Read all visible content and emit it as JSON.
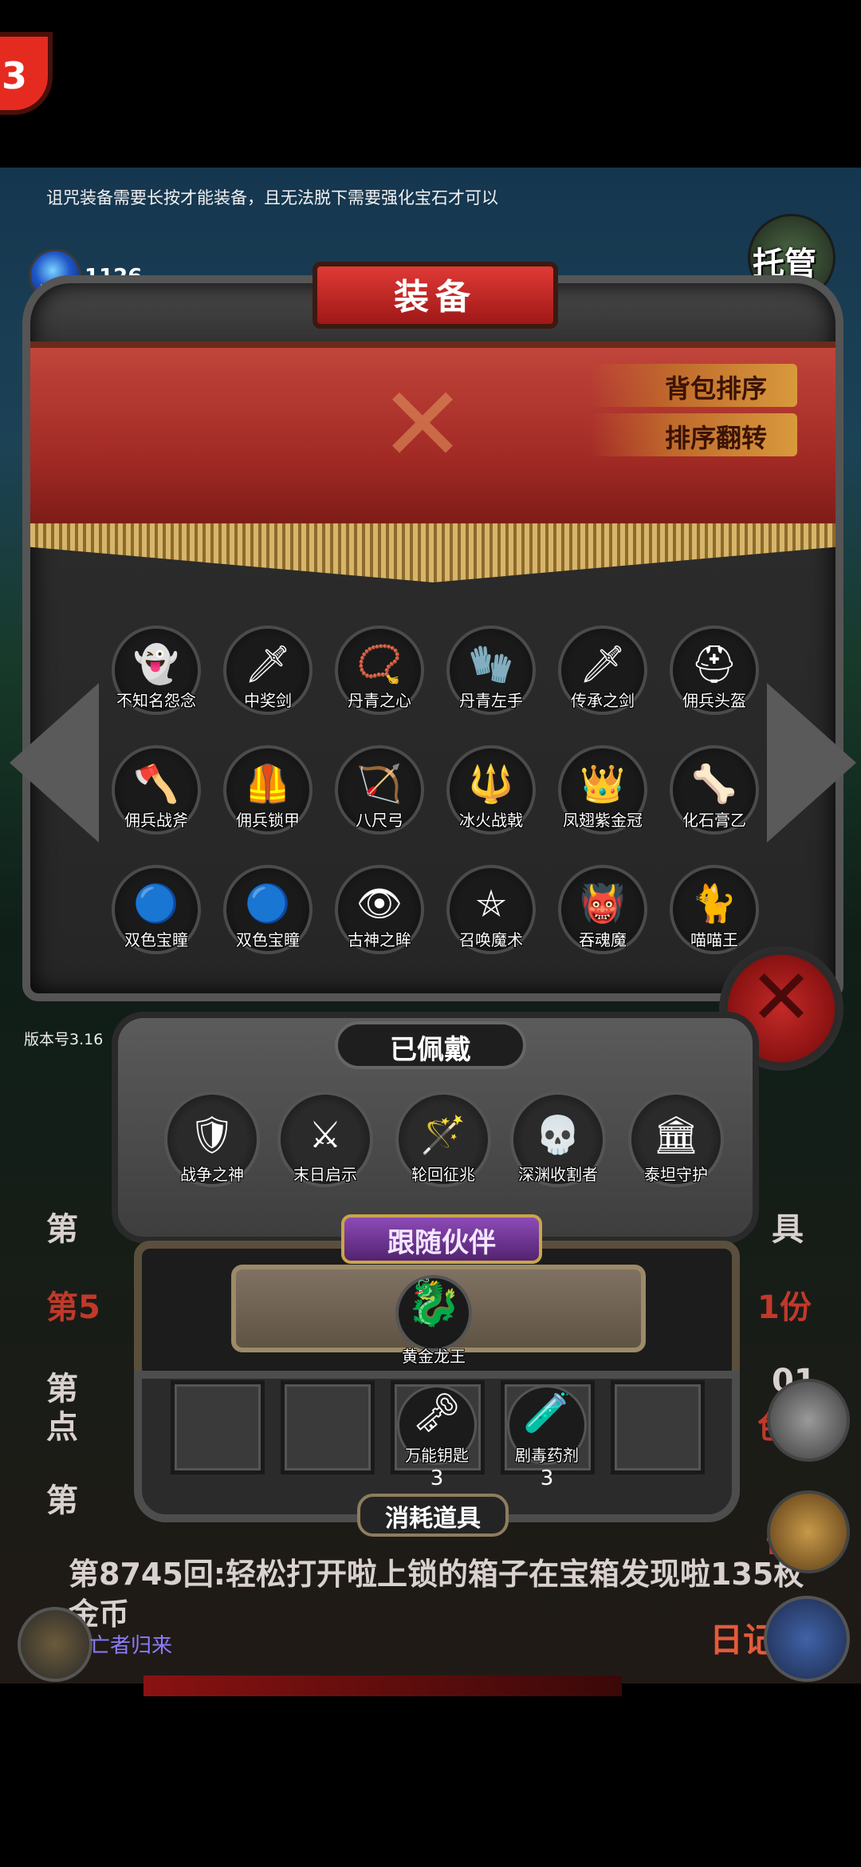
{
  "hint": "诅咒装备需要长按才能装备，且无法脱下需要强化宝石才可以",
  "gems": {
    "count": "1126",
    "label": "宝石"
  },
  "auto_label": "托管",
  "version": "版本号3.16",
  "equip_panel": {
    "title": "装备",
    "sort_button": "背包排序",
    "reverse_button": "排序翻转",
    "items": [
      {
        "name": "不知名怨念",
        "icon": "ghost-icon",
        "glyph": "👻"
      },
      {
        "name": "中奖剑",
        "icon": "sword-icon",
        "glyph": "🗡"
      },
      {
        "name": "丹青之心",
        "icon": "amulet-icon",
        "glyph": "📿"
      },
      {
        "name": "丹青左手",
        "icon": "glove-icon",
        "glyph": "🧤"
      },
      {
        "name": "传承之剑",
        "icon": "sword-icon",
        "glyph": "🗡"
      },
      {
        "name": "佣兵头盔",
        "icon": "helmet-icon",
        "glyph": "⛑"
      },
      {
        "name": "佣兵战斧",
        "icon": "axe-icon",
        "glyph": "🪓"
      },
      {
        "name": "佣兵锁甲",
        "icon": "armor-icon",
        "glyph": "🦺"
      },
      {
        "name": "八尺弓",
        "icon": "bow-icon",
        "glyph": "🏹"
      },
      {
        "name": "冰火战戟",
        "icon": "halberd-icon",
        "glyph": "🔱"
      },
      {
        "name": "凤翅紫金冠",
        "icon": "crown-icon",
        "glyph": "👑"
      },
      {
        "name": "化石膏乙",
        "icon": "bone-icon",
        "glyph": "🦴"
      },
      {
        "name": "双色宝瞳",
        "icon": "pendant-icon",
        "glyph": "🔵"
      },
      {
        "name": "双色宝瞳",
        "icon": "pendant-icon",
        "glyph": "🔵"
      },
      {
        "name": "古神之眸",
        "icon": "eye-icon",
        "glyph": "👁"
      },
      {
        "name": "召唤魔术",
        "icon": "pentagram-icon",
        "glyph": "⛤"
      },
      {
        "name": "吞魂魔",
        "icon": "demon-icon",
        "glyph": "👹"
      },
      {
        "name": "喵喵王",
        "icon": "cat-icon",
        "glyph": "🐈"
      }
    ]
  },
  "worn_panel": {
    "title": "已佩戴",
    "items": [
      {
        "name": "战争之神",
        "icon": "war-god-icon",
        "glyph": "🛡"
      },
      {
        "name": "末日启示",
        "icon": "crossed-weapons-icon",
        "glyph": "⚔"
      },
      {
        "name": "轮回征兆",
        "icon": "staff-icon",
        "glyph": "🪄"
      },
      {
        "name": "深渊收割者",
        "icon": "reaper-icon",
        "glyph": "💀"
      },
      {
        "name": "泰坦守护",
        "icon": "titan-armor-icon",
        "glyph": "🏛"
      }
    ]
  },
  "companion": {
    "title": "跟随伙伴",
    "name": "黄金龙王",
    "icon": "golden-dragon-icon",
    "glyph": "🐉"
  },
  "consumables": {
    "title": "消耗道具",
    "items": [
      {
        "name": "",
        "qty": ""
      },
      {
        "name": "",
        "qty": ""
      },
      {
        "name": "万能钥匙",
        "qty": "3",
        "icon": "key-icon",
        "glyph": "🗝"
      },
      {
        "name": "剧毒药剂",
        "qty": "3",
        "icon": "potion-icon",
        "glyph": "🧪"
      },
      {
        "name": "",
        "qty": ""
      }
    ]
  },
  "journal": {
    "line1_left": "第",
    "line1_right": "具",
    "line2_left": "第5",
    "line2_right": "1份",
    "line3_left": "第",
    "line3_right": "01",
    "line4_left": "点",
    "line4_right": "色",
    "line5_left": "第",
    "line5_right": "击",
    "line6": "第8745回:轻松打开啦上锁的箱子在宝箱发现啦135枚",
    "line7": "金币"
  },
  "bottom": {
    "dead_return": "亡者归来",
    "diary": "日记"
  },
  "colors": {
    "banner": "#a22a25",
    "title_plate": "#d0302c",
    "close_button": "#c22a27",
    "companion_tag": "#8d4bb8",
    "dead_return": "#8b7cff",
    "diary": "#e55a3a"
  }
}
